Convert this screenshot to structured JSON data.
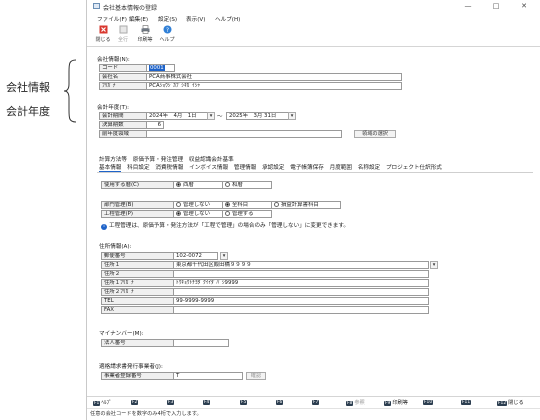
{
  "annotation": {
    "line1": "会社情報",
    "line2": "会計年度"
  },
  "window": {
    "title": "会社基本情報の登録",
    "minimize": "—",
    "maximize": "□",
    "close": "✕"
  },
  "menu": [
    "ファイル(F)",
    "編集(E)",
    "設定(S)",
    "表示(V)",
    "ヘルプ(H)"
  ],
  "toolbar": {
    "close": "閉じる",
    "select_all": "全行",
    "print": "印刷等",
    "help": "ヘルプ"
  },
  "company": {
    "section": "会社情報(N):",
    "code_label": "コード",
    "code_value": "0001",
    "name_label": "会社名",
    "name_value": "PCA商事株式会社",
    "kana_label": "ﾌﾘｶﾞﾅ",
    "kana_value": "PCAｼｮｳｼﾞｶﾌﾞｼｷｶﾞｲｼｬ"
  },
  "fiscal": {
    "section": "会計年度(T):",
    "period_label": "会計期間",
    "start": "2024年　4月　1日",
    "tilde": "～",
    "end": "2025年　3月 31日",
    "term_label": "決算期数",
    "term_value": "6",
    "prev_label": "前年度領域",
    "prev_button": "領域の選択"
  },
  "tabs_row1": [
    "計算方法等",
    "原価予算・発注管理",
    "収益認識会計基準"
  ],
  "tabs_row2": [
    "基本情報",
    "科目設定",
    "消費税情報",
    "インボイス情報",
    "管理情報",
    "承認設定",
    "電子帳簿保存",
    "月度範囲",
    "名称設定",
    "プロジェクト仕訳形式"
  ],
  "basic": {
    "era_label": "使用する暦(C)",
    "era_option1": "西暦",
    "era_option2": "和暦",
    "dept_label": "部門管理(B)",
    "dept_option1": "管理しない",
    "dept_option2": "全科目",
    "dept_option3": "損益計算書科目",
    "process_label": "工程管理(P)",
    "process_option1": "管理しない",
    "process_option2": "管理する",
    "notice": "工程管理は、原価予算・発注方法が「工程で管理」の場合のみ「管理しない」に変更できます。",
    "notice_icon": "i"
  },
  "address": {
    "section": "住所情報(A):",
    "rows": [
      {
        "label": "郵便番号",
        "value": "102-0072"
      },
      {
        "label": "住所１",
        "value": "東京都千代田区飯田橋９９９９"
      },
      {
        "label": "住所２",
        "value": ""
      },
      {
        "label": "住所１ﾌﾘｶﾞﾅ",
        "value": "ﾄｳｷｮｳﾄﾁﾖﾀﾞｸｲｲﾀﾞﾊﾞｼ9999"
      },
      {
        "label": "住所２ﾌﾘｶﾞﾅ",
        "value": ""
      },
      {
        "label": "TEL",
        "value": "99-9999-9999"
      },
      {
        "label": "FAX",
        "value": ""
      }
    ]
  },
  "mynumber": {
    "section": "マイナンバー(M):",
    "corp_label": "法人番号",
    "corp_value": ""
  },
  "invoice": {
    "section": "適格請求書発行事業者(J):",
    "reg_label": "事業者登録番号",
    "reg_prefix": "T",
    "confirm": "確認"
  },
  "fkeys": [
    {
      "key": "F1",
      "label": "ﾍﾙﾌﾟ",
      "dim": false
    },
    {
      "key": "F2",
      "label": "",
      "dim": true
    },
    {
      "key": "F3",
      "label": "",
      "dim": true
    },
    {
      "key": "F4",
      "label": "",
      "dim": true
    },
    {
      "key": "F5",
      "label": "",
      "dim": true
    },
    {
      "key": "F6",
      "label": "",
      "dim": true
    },
    {
      "key": "F7",
      "label": "",
      "dim": true
    },
    {
      "key": "F8",
      "label": "参照",
      "dim": true
    },
    {
      "key": "F9",
      "label": "印刷等",
      "dim": false
    },
    {
      "key": "F10",
      "label": "",
      "dim": true
    },
    {
      "key": "F11",
      "label": "",
      "dim": true
    },
    {
      "key": "F12",
      "label": "閉じる",
      "dim": false
    }
  ],
  "status": "任意の会社コードを数字のみ4桁で入力します。"
}
